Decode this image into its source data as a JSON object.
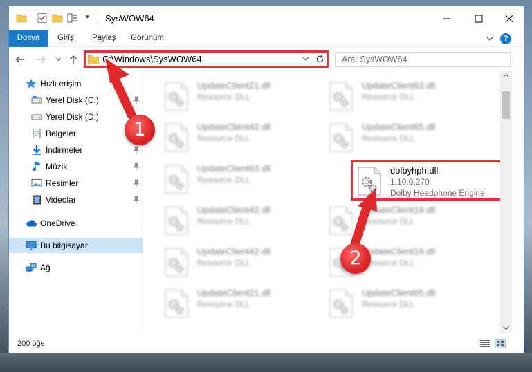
{
  "window": {
    "title": "SysWOW64"
  },
  "ribbon": {
    "tabs": [
      "Dosya",
      "Giriş",
      "Paylaş",
      "Görünüm"
    ],
    "help": "?"
  },
  "nav": {
    "address": "C:\\Windows\\SysWOW64",
    "search_placeholder": "Ara: SysWOW64"
  },
  "sidebar": {
    "items": [
      {
        "label": "Hızlı erişim",
        "icon": "star-icon",
        "pinned": false
      },
      {
        "label": "Yerel Disk (C:)",
        "icon": "drive-icon",
        "pinned": true
      },
      {
        "label": "Yerel Disk (D:)",
        "icon": "drive-icon",
        "pinned": false
      },
      {
        "label": "Belgeler",
        "icon": "documents-icon",
        "pinned": true
      },
      {
        "label": "İndirmeler",
        "icon": "download-icon",
        "pinned": true
      },
      {
        "label": "Müzik",
        "icon": "music-icon",
        "pinned": true
      },
      {
        "label": "Resimler",
        "icon": "pictures-icon",
        "pinned": true
      },
      {
        "label": "Videolar",
        "icon": "videos-icon",
        "pinned": true
      },
      {
        "label": "OneDrive",
        "icon": "cloud-icon",
        "pinned": false
      },
      {
        "label": "Bu bilgisayar",
        "icon": "computer-icon",
        "pinned": false,
        "selected": true
      },
      {
        "label": "Ağ",
        "icon": "network-icon",
        "pinned": false
      }
    ]
  },
  "files": [
    {
      "name": "UpdateClient21.dll",
      "line2": "Resource DLL",
      "line3": ""
    },
    {
      "name": "UpdateClient63.dll",
      "line2": "Resource DLL",
      "line3": ""
    },
    {
      "name": "UpdateClient42.dll",
      "line2": "Resource DLL",
      "line3": ""
    },
    {
      "name": "UpdateClient65.dll",
      "line2": "Resource DLL",
      "line3": ""
    },
    {
      "name": "UpdateClient63.dll",
      "line2": "Resource DLL",
      "line3": ""
    },
    {
      "name": "dolbyhph.dll",
      "line2": "1.10.0.270",
      "line3": "Dolby Headphone Engine",
      "highlighted": true
    },
    {
      "name": "UpdateClient42.dll",
      "line2": "Resource DLL",
      "line3": ""
    },
    {
      "name": "UpdateClient19.dll",
      "line2": "Resource DLL",
      "line3": ""
    },
    {
      "name": "UpdateClient42.dll",
      "line2": "Resource DLL",
      "line3": ""
    },
    {
      "name": "UpdateClient19.dll",
      "line2": "Resource DLL",
      "line3": ""
    },
    {
      "name": "UpdateClient21.dll",
      "line2": "Resource DLL",
      "line3": ""
    },
    {
      "name": "UpdateClient65.dll",
      "line2": "Resource DLL",
      "line3": ""
    }
  ],
  "status": {
    "count": "200 öğe"
  },
  "annotations": {
    "step1": "1",
    "step2": "2",
    "color": "#d9383a"
  }
}
